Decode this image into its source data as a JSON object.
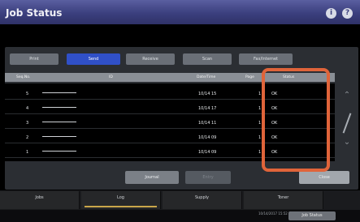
{
  "window": {
    "title": "Job Status"
  },
  "title_icons": [
    "info-icon",
    "help-icon"
  ],
  "tabs": [
    {
      "label": "Print",
      "active": false
    },
    {
      "label": "Send",
      "active": true
    },
    {
      "label": "Receive",
      "active": false
    },
    {
      "label": "Scan",
      "active": false
    },
    {
      "label": "Fax/Internet",
      "active": false
    }
  ],
  "table": {
    "headers": [
      "Seq.No.",
      "ID",
      "Date/Time",
      "Page",
      "Status"
    ],
    "rows": [
      {
        "seq": "5",
        "time": "10/14 15",
        "page": "1",
        "status": "OK"
      },
      {
        "seq": "4",
        "time": "10/14 17",
        "page": "1",
        "status": "OK"
      },
      {
        "seq": "3",
        "time": "10/14 11",
        "page": "1",
        "status": "OK"
      },
      {
        "seq": "2",
        "time": "10/14 09",
        "page": "1",
        "status": "OK"
      },
      {
        "seq": "1",
        "time": "10/14 09",
        "page": "1",
        "status": "OK"
      }
    ]
  },
  "buttons": {
    "journal": "Journal",
    "entry": "Entry",
    "close": "Close"
  },
  "nav": [
    {
      "label": "Jobs",
      "active": false
    },
    {
      "label": "Log",
      "active": true
    },
    {
      "label": "Supply",
      "active": false
    },
    {
      "label": "Toner",
      "active": false
    }
  ],
  "footer": {
    "datetime": "10/14/2017 15:52",
    "job_status": "Job Status"
  },
  "colors": {
    "accent": "#3050c8",
    "highlight": "#e0643a",
    "titlebar": "#3b3f7e"
  }
}
